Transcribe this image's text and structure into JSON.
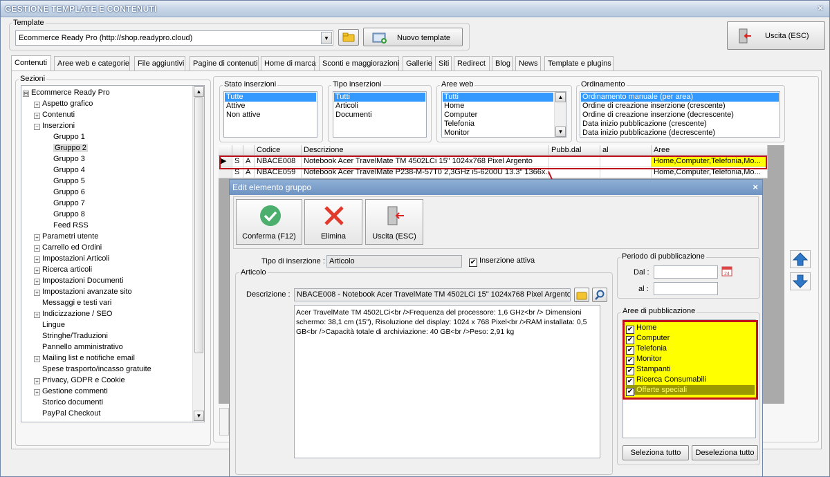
{
  "window": {
    "title": "GESTIONE TEMPLATE E CONTENUTI",
    "close": "×"
  },
  "template": {
    "legend": "Template",
    "value": "Ecommerce Ready Pro (http://shop.readypro.cloud)",
    "new_button": "Nuovo template",
    "exit_button": "Uscita (ESC)"
  },
  "tabs": [
    "Contenuti",
    "Aree web e categorie",
    "File aggiuntivi",
    "Pagine di contenuti",
    "Home di marca",
    "Sconti e maggiorazioni",
    "Gallerie",
    "Siti",
    "Redirect",
    "Blog",
    "News",
    "Template e plugins"
  ],
  "sections": {
    "legend": "Sezioni",
    "tree": [
      {
        "label": "Ecommerce Ready Pro",
        "level": 0,
        "toggle": "⊟"
      },
      {
        "label": "Aspetto grafico",
        "level": 1,
        "toggle": "+"
      },
      {
        "label": "Contenuti",
        "level": 1,
        "toggle": "+"
      },
      {
        "label": "Inserzioni",
        "level": 1,
        "toggle": "−"
      },
      {
        "label": "Gruppo 1",
        "level": 2,
        "toggle": ""
      },
      {
        "label": "Gruppo 2",
        "level": 2,
        "toggle": "",
        "selected": true
      },
      {
        "label": "Gruppo 3",
        "level": 2,
        "toggle": ""
      },
      {
        "label": "Gruppo 4",
        "level": 2,
        "toggle": ""
      },
      {
        "label": "Gruppo 5",
        "level": 2,
        "toggle": ""
      },
      {
        "label": "Gruppo 6",
        "level": 2,
        "toggle": ""
      },
      {
        "label": "Gruppo 7",
        "level": 2,
        "toggle": ""
      },
      {
        "label": "Gruppo 8",
        "level": 2,
        "toggle": ""
      },
      {
        "label": "Feed RSS",
        "level": 2,
        "toggle": ""
      },
      {
        "label": "Parametri utente",
        "level": 1,
        "toggle": "+"
      },
      {
        "label": "Carrello ed Ordini",
        "level": 1,
        "toggle": "+"
      },
      {
        "label": "Impostazioni Articoli",
        "level": 1,
        "toggle": "+"
      },
      {
        "label": "Ricerca articoli",
        "level": 1,
        "toggle": "+"
      },
      {
        "label": "Impostazioni Documenti",
        "level": 1,
        "toggle": "+"
      },
      {
        "label": "Impostazioni avanzate sito",
        "level": 1,
        "toggle": "+"
      },
      {
        "label": "Messaggi e testi vari",
        "level": 1,
        "toggle": ""
      },
      {
        "label": "Indicizzazione / SEO",
        "level": 1,
        "toggle": "+"
      },
      {
        "label": "Lingue",
        "level": 1,
        "toggle": ""
      },
      {
        "label": "Stringhe/Traduzioni",
        "level": 1,
        "toggle": ""
      },
      {
        "label": "Pannello amministrativo",
        "level": 1,
        "toggle": ""
      },
      {
        "label": "Mailing list e notifiche email",
        "level": 1,
        "toggle": "+"
      },
      {
        "label": "Spese trasporto/incasso gratuite",
        "level": 1,
        "toggle": ""
      },
      {
        "label": "Privacy, GDPR e Cookie",
        "level": 1,
        "toggle": "+"
      },
      {
        "label": "Gestione commenti",
        "level": 1,
        "toggle": "+"
      },
      {
        "label": "Storico documenti",
        "level": 1,
        "toggle": ""
      },
      {
        "label": "PayPal Checkout",
        "level": 1,
        "toggle": ""
      }
    ]
  },
  "filters": {
    "stato": {
      "legend": "Stato inserzioni",
      "items": [
        "Tutte",
        "Attive",
        "Non attive"
      ]
    },
    "tipo": {
      "legend": "Tipo inserzioni",
      "items": [
        "Tutti",
        "Articoli",
        "Documenti"
      ]
    },
    "aree": {
      "legend": "Aree web",
      "items": [
        "Tutti",
        "Home",
        "Computer",
        "Telefonia",
        "Monitor"
      ]
    },
    "ordinamento": {
      "legend": "Ordinamento",
      "items": [
        "Ordinamento manuale (per area)",
        "Ordine di creazione inserzione (crescente)",
        "Ordine di creazione inserzione (decrescente)",
        "Data inizio pubblicazione (crescente)",
        "Data inizio pubblicazione (decrescente)"
      ]
    }
  },
  "grid": {
    "headers": [
      "",
      "",
      "",
      "Codice",
      "Descrizione",
      "Pubb.dal",
      "al",
      "Aree"
    ],
    "rows": [
      {
        "marker": "▶",
        "s": "S",
        "a": "A",
        "codice": "NBACE008",
        "descrizione": "Notebook Acer TravelMate TM 4502LCi 15\" 1024x768 Pixel Argento",
        "dal": "",
        "al": "",
        "aree": "Home,Computer,Telefonia,Mo..."
      },
      {
        "marker": "",
        "s": "S",
        "a": "A",
        "codice": "NBACE059",
        "descrizione": "Notebook Acer TravelMate P238-M-57T0 2,3GHz i5-6200U 13.3\" 1366x...",
        "dal": "",
        "al": "",
        "aree": "Home,Computer,Telefonia,Mo..."
      }
    ]
  },
  "dialog": {
    "title": "Edit elemento gruppo",
    "close": "×",
    "confirm": "Conferma (F12)",
    "delete": "Elimina",
    "exit": "Uscita (ESC)",
    "tipo_label": "Tipo di inserzione :",
    "tipo_value": "Articolo",
    "attiva_label": "Inserzione attiva",
    "articolo_legend": "Articolo",
    "descr_label": "Descrizione :",
    "descr_value": "NBACE008 - Notebook Acer TravelMate TM 4502LCi 15\" 1024x768 Pixel Argento",
    "body_text": "Acer TravelMate TM 4502LCi<br />Frequenza del processore: 1,6 GHz<br /> Dimensioni schermo: 38,1 cm (15\"), Risoluzione del display: 1024 x 768 Pixel<br />RAM installata: 0,5 GB<br />Capacità totale di archiviazione: 40 GB<br />Peso: 2,91 kg",
    "periodo_legend": "Periodo di pubblicazione",
    "dal_label": "Dal :",
    "al_label": "al :",
    "aree_legend": "Aree di pubblicazione",
    "aree": [
      "Home",
      "Computer",
      "Telefonia",
      "Monitor",
      "Stampanti",
      "Ricerca Consumabili",
      "Offerte speciali"
    ],
    "select_all": "Seleziona tutto",
    "deselect_all": "Deseleziona tutto"
  },
  "colors": {
    "highlight": "#ffff00",
    "red_frame": "#c0101c",
    "accent": "#3399ff",
    "green": "#4caf6e"
  }
}
